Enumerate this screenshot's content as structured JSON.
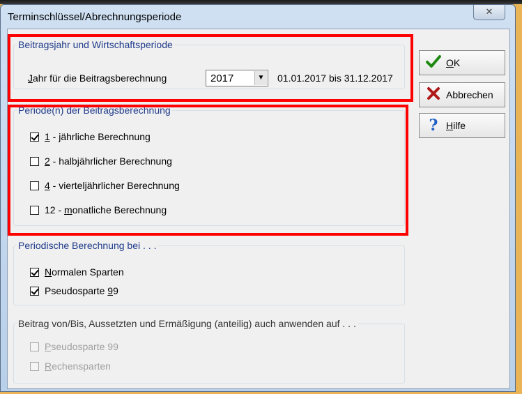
{
  "window": {
    "title": "Terminschlüssel/Abrechnungsperiode",
    "close_glyph": "✕"
  },
  "group_year": {
    "legend": "Beitragsjahr und Wirtschaftsperiode",
    "field_label_u": "J",
    "field_label_rest": "ahr für die Beitragsberechnung",
    "selected_year": "2017",
    "date_range": "01.01.2017 bis 31.12.2017"
  },
  "group_period": {
    "legend": "Periode(n) der Beitragsberechnung",
    "options": [
      {
        "u": "1",
        "rest": " - jährliche Berechnung",
        "checked": true
      },
      {
        "u": "2",
        "rest": " - halbjährlicher Berechnung",
        "checked": false
      },
      {
        "u": "4",
        "rest": " - vierteljährlicher Berechnung",
        "checked": false
      },
      {
        "pre": "12 - ",
        "u": "m",
        "rest": "onatliche Berechnung",
        "checked": false
      }
    ]
  },
  "group_periodic": {
    "legend": "Periodische Berechnung bei . . .",
    "options": [
      {
        "u": "N",
        "rest": "ormalen Sparten",
        "checked": true
      },
      {
        "pre": "Pseudosparte ",
        "u": "9",
        "rest": "9",
        "checked": true
      }
    ]
  },
  "group_apply": {
    "legend": "Beitrag von/Bis, Aussetzten und Ermäßigung (anteilig) auch anwenden auf . . .",
    "options": [
      {
        "u": "P",
        "rest": "seudosparte 99",
        "checked": false,
        "disabled": true
      },
      {
        "u": "R",
        "rest": "echensparten",
        "checked": false,
        "disabled": true
      }
    ]
  },
  "buttons": {
    "ok": {
      "u": "O",
      "rest": "K",
      "icon": "check-icon",
      "color": "#1f8a12"
    },
    "cancel": {
      "label": "Abbrechen",
      "icon": "cross-icon",
      "color": "#b01818"
    },
    "help": {
      "u": "H",
      "rest": "ilfe",
      "icon": "question-icon",
      "color": "#1e5fc4"
    }
  },
  "highlight_color": "#ff0000"
}
